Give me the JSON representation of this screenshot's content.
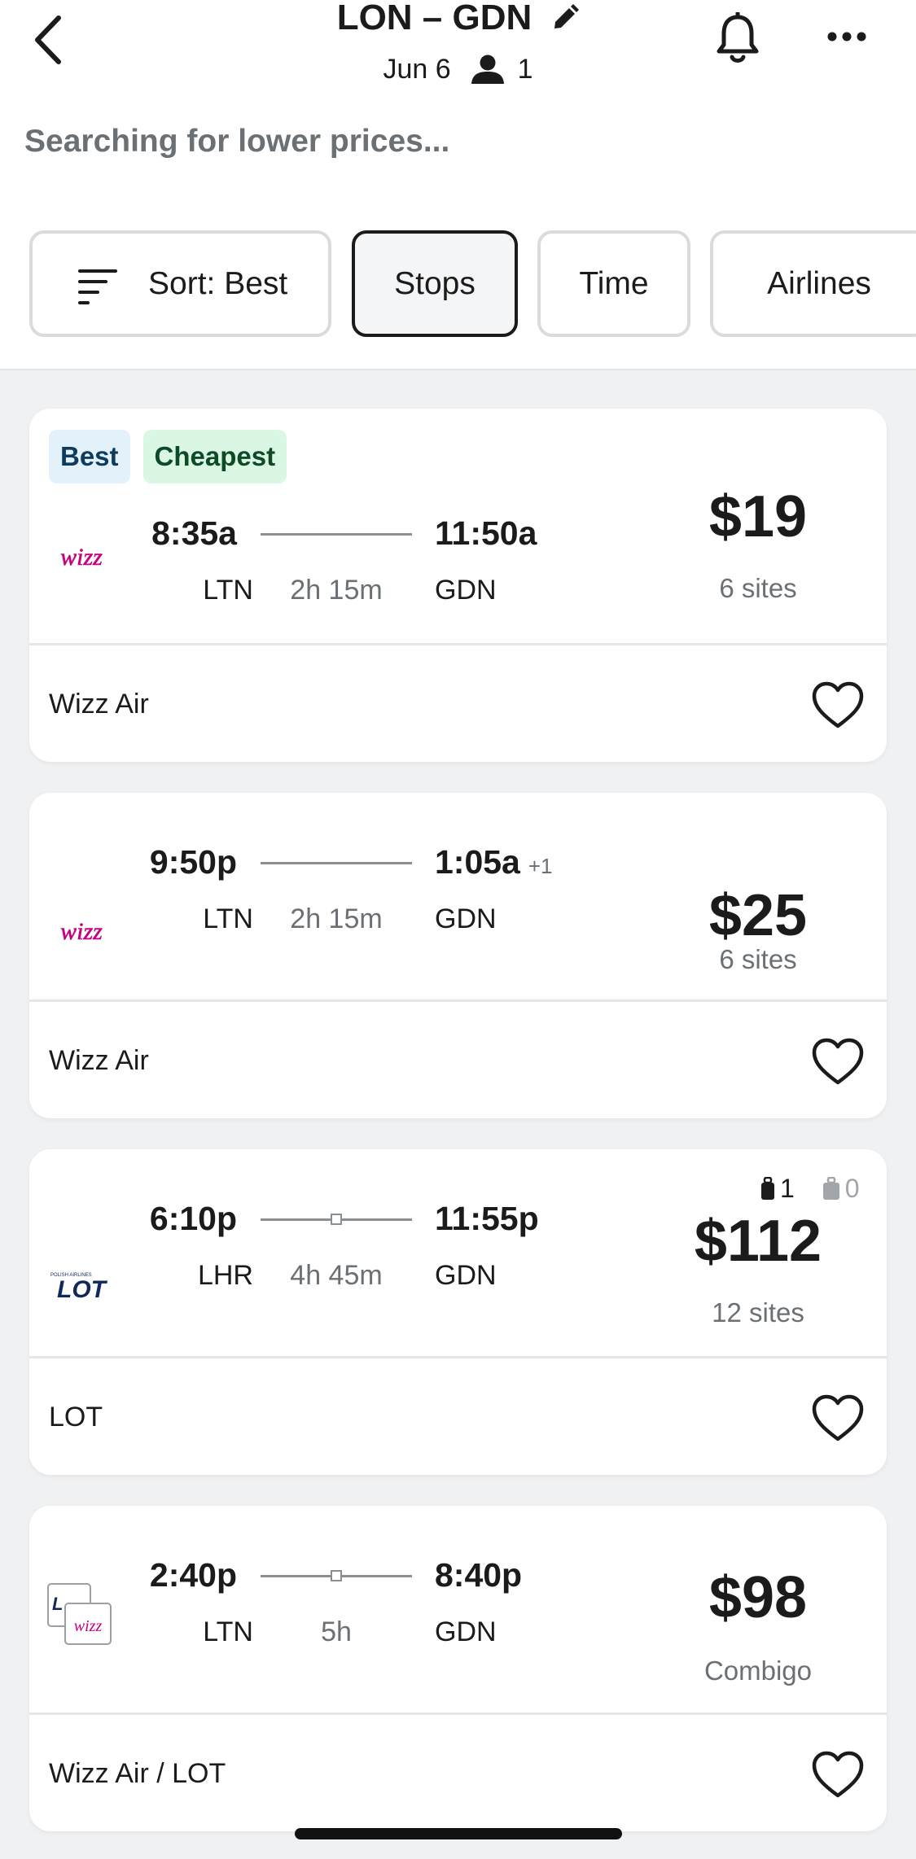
{
  "header": {
    "route": "LON – GDN",
    "date": "Jun 6",
    "passengers": "1",
    "status": "Searching for lower prices..."
  },
  "filters": {
    "sort_label": "Sort: Best",
    "stops_label": "Stops",
    "time_label": "Time",
    "airlines_label": "Airlines"
  },
  "results": [
    {
      "badges": [
        "Best",
        "Cheapest"
      ],
      "dep_time": "8:35a",
      "arr_time": "11:50a",
      "plus_day": "",
      "dep_airport": "LTN",
      "arr_airport": "GDN",
      "duration": "2h 15m",
      "price": "$19",
      "sites": "6 sites",
      "airline": "Wizz Air",
      "logo_text": "wizz",
      "logo_icon": "wizz-air-logo"
    },
    {
      "dep_time": "9:50p",
      "arr_time": "1:05a",
      "plus_day": "+1",
      "dep_airport": "LTN",
      "arr_airport": "GDN",
      "duration": "2h 15m",
      "price": "$25",
      "sites": "6 sites",
      "airline": "Wizz Air",
      "logo_text": "wizz",
      "logo_icon": "wizz-air-logo"
    },
    {
      "dep_time": "6:10p",
      "arr_time": "11:55p",
      "dep_airport": "LHR",
      "arr_airport": "GDN",
      "duration": "4h 45m",
      "price": "$112",
      "sites": "12 sites",
      "airline": "LOT",
      "carry_on_count": "1",
      "checked_bag_count": "0",
      "logo_text": "LOT",
      "logo_subtext": "POLISH AIRLINES",
      "logo_icon": "lot-logo"
    },
    {
      "dep_time": "2:40p",
      "arr_time": "8:40p",
      "dep_airport": "LTN",
      "arr_airport": "GDN",
      "duration": "5h",
      "price": "$98",
      "sites": "Combigo",
      "airline": "Wizz Air / LOT",
      "logo_text": "wizz",
      "logo_icon": "combined-airline-logo"
    }
  ],
  "colors": {
    "badge_best_bg": "#e3f1fb",
    "badge_cheapest_bg": "#d9f7e2",
    "wizz_pink": "#c6007e",
    "lot_navy": "#11285c",
    "muted_text": "#6b7074"
  }
}
